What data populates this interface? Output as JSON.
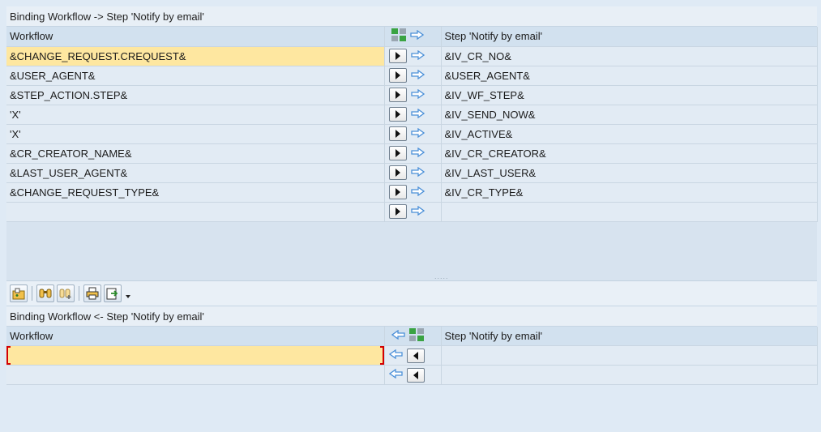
{
  "top": {
    "title": "Binding Workflow  -> Step 'Notify by email'",
    "col_left": "Workflow",
    "col_right": "Step 'Notify by email'",
    "rows": [
      {
        "left": "&CHANGE_REQUEST.CREQUEST&",
        "right": "&IV_CR_NO&"
      },
      {
        "left": "&USER_AGENT&",
        "right": "&USER_AGENT&"
      },
      {
        "left": "&STEP_ACTION.STEP&",
        "right": "&IV_WF_STEP&"
      },
      {
        "left": "'X'",
        "right": "&IV_SEND_NOW&"
      },
      {
        "left": "'X'",
        "right": "&IV_ACTIVE&"
      },
      {
        "left": "&CR_CREATOR_NAME&",
        "right": "&IV_CR_CREATOR&"
      },
      {
        "left": "&LAST_USER_AGENT&",
        "right": "&IV_LAST_USER&"
      },
      {
        "left": "&CHANGE_REQUEST_TYPE&",
        "right": "&IV_CR_TYPE&"
      },
      {
        "left": "",
        "right": ""
      }
    ]
  },
  "bottom": {
    "title": "Binding Workflow  <- Step 'Notify by email'",
    "col_left": "Workflow",
    "col_right": "Step 'Notify by email'",
    "rows": [
      {
        "left": "",
        "right": ""
      },
      {
        "left": "",
        "right": ""
      }
    ]
  },
  "colors": {
    "selected_row": "#fee7a0",
    "arrow_blue": "#4a8fd8",
    "header_bg": "#d2e1ef"
  }
}
